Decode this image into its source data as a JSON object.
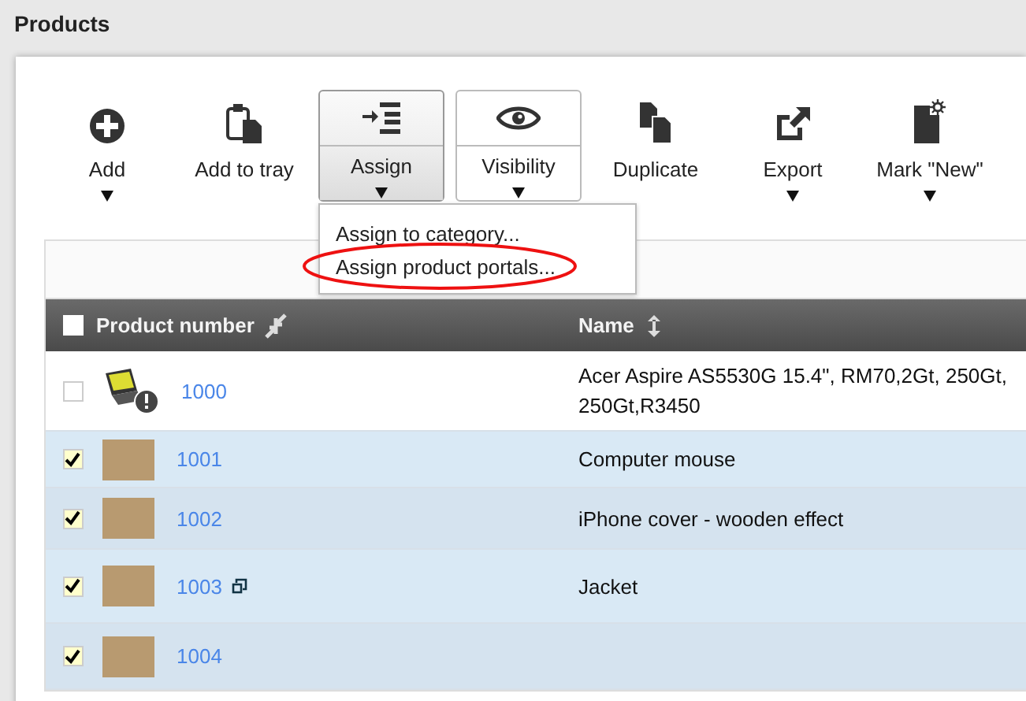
{
  "page_title": "Products",
  "toolbar": [
    {
      "label": "Add",
      "kind": "plain",
      "has_menu": true
    },
    {
      "label": "Add to tray",
      "kind": "plain",
      "has_menu": false
    },
    {
      "label": "Assign",
      "kind": "split",
      "has_menu": true,
      "expanded": true
    },
    {
      "label": "Visibility",
      "kind": "split",
      "has_menu": true,
      "expanded": false
    },
    {
      "label": "Duplicate",
      "kind": "plain",
      "has_menu": false
    },
    {
      "label": "Export",
      "kind": "plain",
      "has_menu": true
    },
    {
      "label": "Mark \"New\"",
      "kind": "plain",
      "has_menu": true
    }
  ],
  "assign_menu": [
    {
      "label": "Assign to category...",
      "highlighted": false
    },
    {
      "label": "Assign product portals...",
      "highlighted": true
    }
  ],
  "table": {
    "select_all_checked": false,
    "columns": [
      "Product number",
      "Name"
    ],
    "rows": [
      {
        "selected": false,
        "number": "1000",
        "has_variants": false,
        "warning": true,
        "name_lines": [
          "Acer Aspire AS5530G 15.4\", RM70,2Gt, 250Gt,",
          "250Gt,R3450"
        ]
      },
      {
        "selected": true,
        "number": "1001",
        "has_variants": false,
        "warning": false,
        "name_lines": [
          "Computer mouse"
        ]
      },
      {
        "selected": true,
        "number": "1002",
        "has_variants": false,
        "warning": false,
        "name_lines": [
          "iPhone cover - wooden effect"
        ]
      },
      {
        "selected": true,
        "number": "1003",
        "has_variants": true,
        "warning": false,
        "name_lines": [
          "Jacket"
        ]
      },
      {
        "selected": true,
        "number": "1004",
        "has_variants": false,
        "warning": false,
        "name_lines": []
      }
    ]
  }
}
